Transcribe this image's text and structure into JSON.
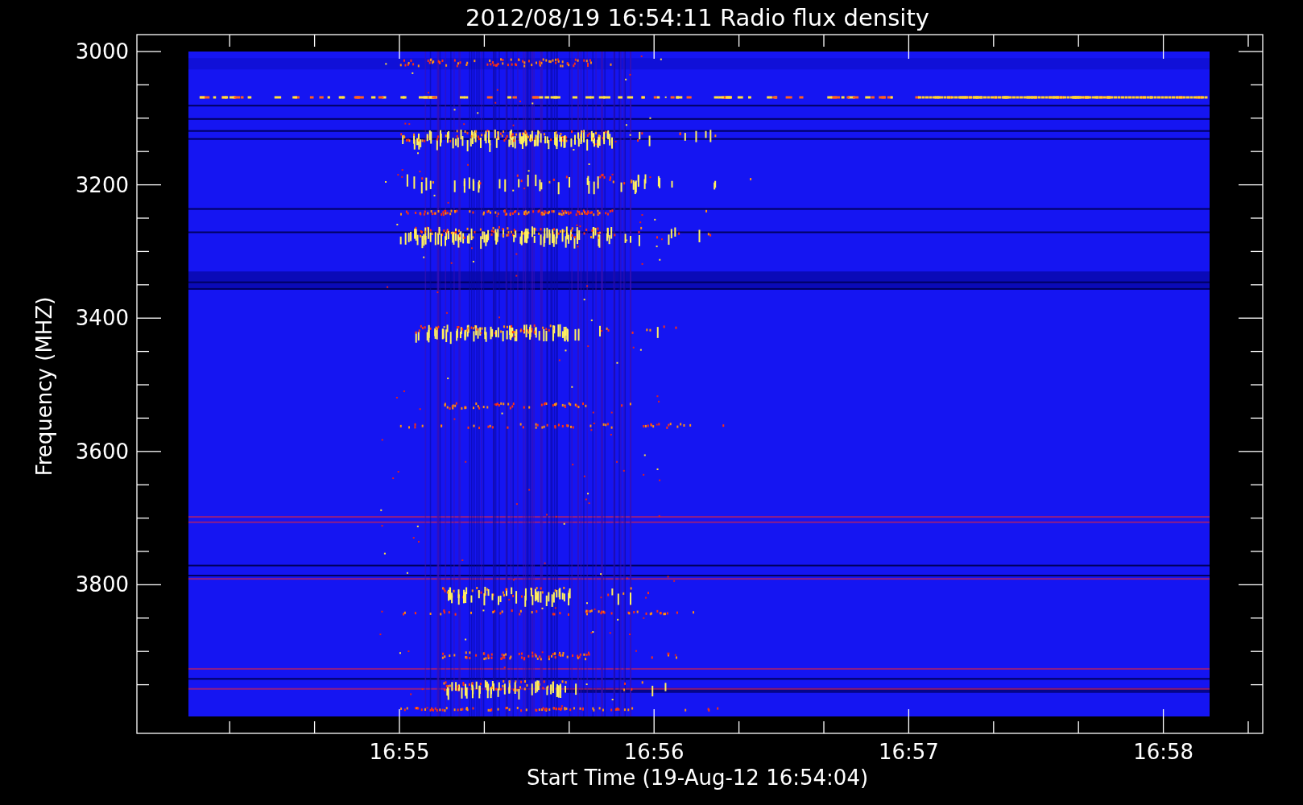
{
  "title": "2012/08/19 16:54:11 Radio flux density",
  "y_axis": {
    "label": "Frequency (MHZ)",
    "ticks": [
      "3000",
      "3200",
      "3400",
      "3600",
      "3800"
    ]
  },
  "x_axis": {
    "label": "Start Time (19-Aug-12 16:54:04)",
    "ticks": [
      "16:55",
      "16:56",
      "16:57",
      "16:58"
    ]
  }
}
